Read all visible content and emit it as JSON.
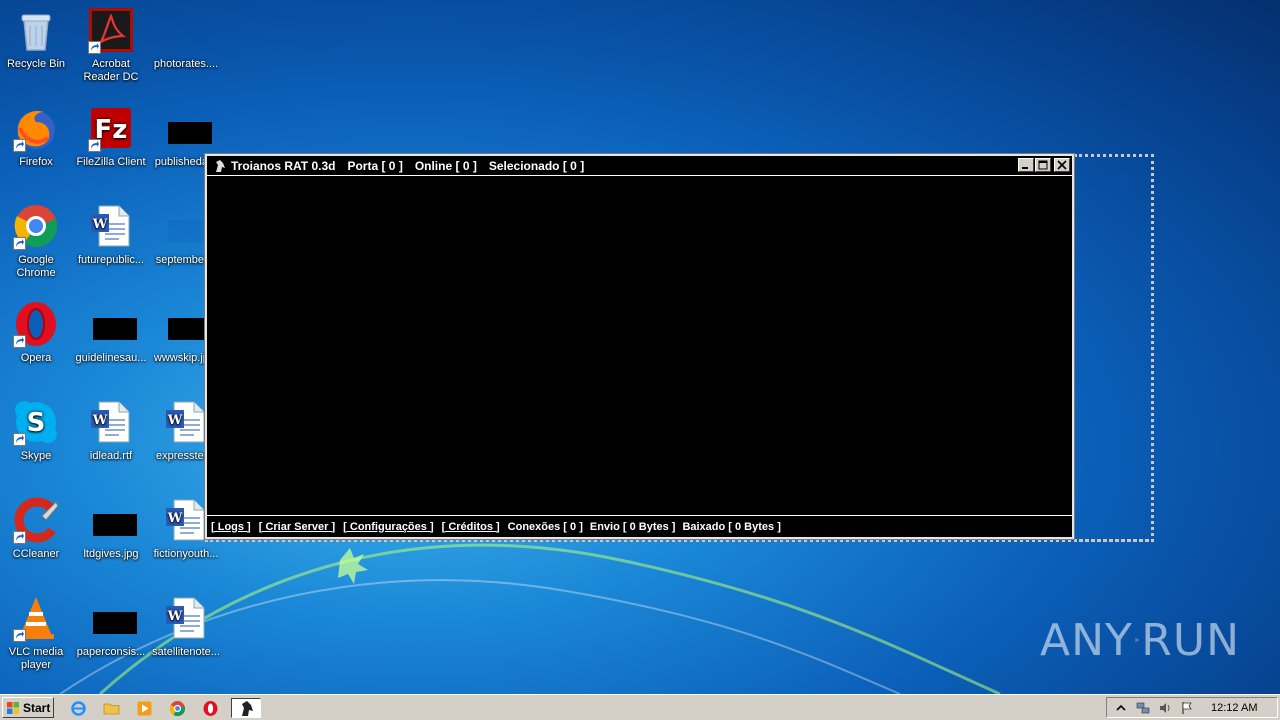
{
  "desktop": {
    "icons": [
      {
        "label": "Recycle Bin",
        "icon": "recycle-bin-icon"
      },
      {
        "label": "Acrobat Reader DC",
        "icon": "acrobat-icon"
      },
      {
        "label": "photorates....",
        "icon": "image-file-icon"
      },
      {
        "label": "Firefox",
        "icon": "firefox-icon"
      },
      {
        "label": "FileZilla Client",
        "icon": "filezilla-icon"
      },
      {
        "label": "publisheda...",
        "icon": "image-file-icon"
      },
      {
        "label": "Google Chrome",
        "icon": "chrome-icon"
      },
      {
        "label": "futurepublic...",
        "icon": "word-doc-icon"
      },
      {
        "label": "september...",
        "icon": "image-file-icon"
      },
      {
        "label": "Opera",
        "icon": "opera-icon"
      },
      {
        "label": "guidelinesau...",
        "icon": "image-file-icon"
      },
      {
        "label": "wwwskip.jp...",
        "icon": "image-file-icon"
      },
      {
        "label": "Skype",
        "icon": "skype-icon"
      },
      {
        "label": "idlead.rtf",
        "icon": "word-doc-icon"
      },
      {
        "label": "expresster...",
        "icon": "word-doc-icon"
      },
      {
        "label": "CCleaner",
        "icon": "ccleaner-icon"
      },
      {
        "label": "ltdgives.jpg",
        "icon": "image-file-icon"
      },
      {
        "label": "fictionyouth...",
        "icon": "word-doc-icon"
      },
      {
        "label": "VLC media player",
        "icon": "vlc-icon"
      },
      {
        "label": "paperconsis...",
        "icon": "image-file-icon"
      },
      {
        "label": "satellitenote...",
        "icon": "word-doc-icon"
      }
    ]
  },
  "app": {
    "title_parts": [
      "Troianos RAT 0.3d",
      "Porta [ 0 ]",
      "Online [ 0 ]",
      "Selecionado [ 0 ]"
    ],
    "status_links": [
      "[ Logs ]",
      "[ Criar Server ]",
      "[ Configurações ]",
      "[ Créditos ]"
    ],
    "status_stats": [
      "Conexões [ 0 ]",
      "Envio [ 0 Bytes ]",
      "Baixado [ 0 Bytes ]"
    ]
  },
  "taskbar": {
    "start_label": "Start",
    "clock": "12:12 AM"
  },
  "watermark": {
    "left": "ANY",
    "right": "RUN"
  },
  "colors": {
    "desktop_blue": "#0b5fb8",
    "taskbar": "#d4d0c8",
    "app_bg": "#000000"
  }
}
